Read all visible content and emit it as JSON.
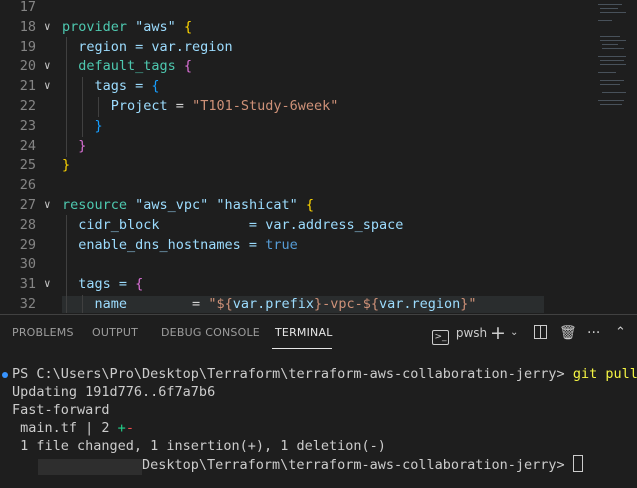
{
  "editor": {
    "lines": [
      {
        "n": "17"
      },
      {
        "n": "18",
        "tokens": [
          {
            "t": "provider ",
            "c": "kw"
          },
          {
            "t": "\"aws\"",
            "c": "strq"
          },
          {
            "t": " ",
            "c": "op"
          },
          {
            "t": "{",
            "c": "b1"
          }
        ]
      },
      {
        "n": "19",
        "tokens": [
          {
            "t": "  region = var.region",
            "c": "prop"
          }
        ]
      },
      {
        "n": "20",
        "tokens": [
          {
            "t": "  default_tags ",
            "c": "kw"
          },
          {
            "t": "{",
            "c": "b2"
          }
        ]
      },
      {
        "n": "21",
        "tokens": [
          {
            "t": "    tags = ",
            "c": "prop"
          },
          {
            "t": "{",
            "c": "b3"
          }
        ]
      },
      {
        "n": "22",
        "tokens": [
          {
            "t": "      Project",
            "c": "prop"
          },
          {
            "t": " = ",
            "c": "op"
          },
          {
            "t": "\"T101-Study-6week\"",
            "c": "str"
          }
        ]
      },
      {
        "n": "23",
        "tokens": [
          {
            "t": "    }",
            "c": "b3"
          }
        ]
      },
      {
        "n": "24",
        "tokens": [
          {
            "t": "  }",
            "c": "b2"
          }
        ]
      },
      {
        "n": "25",
        "tokens": [
          {
            "t": "}",
            "c": "b1"
          }
        ]
      },
      {
        "n": "26"
      },
      {
        "n": "27",
        "tokens": [
          {
            "t": "resource ",
            "c": "kw"
          },
          {
            "t": "\"aws_vpc\" \"hashicat\"",
            "c": "strq"
          },
          {
            "t": " ",
            "c": "op"
          },
          {
            "t": "{",
            "c": "b1"
          }
        ]
      },
      {
        "n": "28",
        "tokens": [
          {
            "t": "  cidr_block           = var.address_space",
            "c": "prop"
          }
        ]
      },
      {
        "n": "29",
        "tokens": [
          {
            "t": "  enable_dns_hostnames = ",
            "c": "prop"
          },
          {
            "t": "true",
            "c": "bool"
          }
        ]
      },
      {
        "n": "30"
      },
      {
        "n": "31",
        "tokens": [
          {
            "t": "  tags = ",
            "c": "prop"
          },
          {
            "t": "{",
            "c": "b2"
          }
        ]
      },
      {
        "n": "32",
        "tokens": [
          {
            "t": "    name",
            "c": "prop"
          },
          {
            "t": "        = ",
            "c": "op"
          },
          {
            "t": "\"${",
            "c": "str"
          },
          {
            "t": "var.prefix",
            "c": "var"
          },
          {
            "t": "}-vpc-${",
            "c": "str"
          },
          {
            "t": "var.region",
            "c": "var"
          },
          {
            "t": "}\"",
            "c": "str"
          }
        ]
      }
    ]
  },
  "panel": {
    "tabs": [
      "PROBLEMS",
      "OUTPUT",
      "DEBUG CONSOLE",
      "TERMINAL"
    ],
    "active_tab": "TERMINAL",
    "shell_label": "pwsh",
    "icons": {
      "shell": "terminal-icon",
      "add": "plus-icon",
      "dropdown": "chevron-down-icon",
      "split": "split-icon",
      "trash": "trash-icon",
      "more": "more-icon",
      "maximize": "chevron-up-icon",
      "close": "close-icon"
    }
  },
  "terminal": {
    "prompt_path": "PS C:\\Users\\Pro\\Desktop\\Terraform\\terraform-aws-collaboration-jerry> ",
    "command": "git pull",
    "output": [
      "Updating 191d776..6f7a7b6",
      "Fast-forward",
      " main.tf | 2 "
    ],
    "diff_plus": "+",
    "diff_minus": "-",
    "summary": " 1 file changed, 1 insertion(+), 1 deletion(-)",
    "second_prompt_tail": "Desktop\\Terraform\\terraform-aws-collaboration-jerry> "
  },
  "colors": {
    "background": "#1e1e1e",
    "accent": "#3794ff",
    "command": "#f5f543"
  }
}
